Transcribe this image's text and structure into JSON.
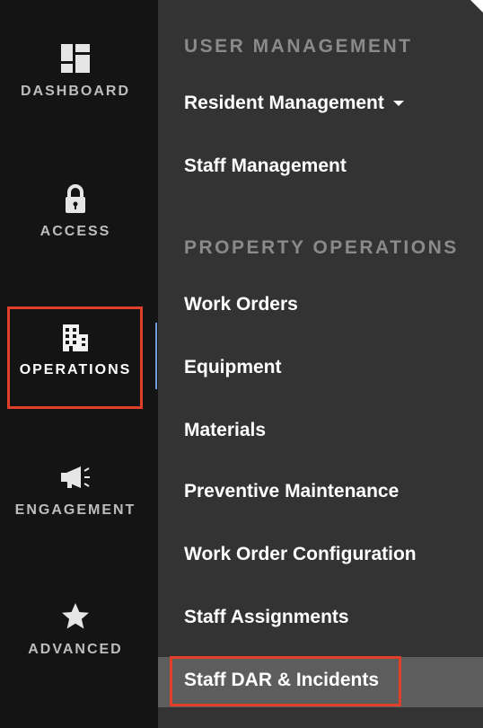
{
  "rail": {
    "items": [
      {
        "label": "DASHBOARD",
        "icon": "dashboard-icon"
      },
      {
        "label": "ACCESS",
        "icon": "lock-icon"
      },
      {
        "label": "OPERATIONS",
        "icon": "building-icon"
      },
      {
        "label": "ENGAGEMENT",
        "icon": "megaphone-icon"
      },
      {
        "label": "ADVANCED",
        "icon": "star-icon"
      }
    ],
    "active": "OPERATIONS"
  },
  "flyout": {
    "sections": [
      {
        "header": "USER MANAGEMENT",
        "items": [
          {
            "label": "Resident Management",
            "has_dropdown": true
          },
          {
            "label": "Staff Management"
          }
        ]
      },
      {
        "header": "PROPERTY OPERATIONS",
        "items": [
          {
            "label": "Work Orders"
          },
          {
            "label": "Equipment"
          },
          {
            "label": "Materials"
          },
          {
            "label": "Preventive Maintenance"
          },
          {
            "label": "Work Order Configuration"
          },
          {
            "label": "Staff Assignments"
          },
          {
            "label": "Staff DAR & Incidents"
          }
        ]
      }
    ],
    "selected": "Staff DAR & Incidents"
  },
  "colors": {
    "rail_bg": "#141414",
    "flyout_bg": "#333333",
    "highlight_box": "#e0402a",
    "active_indicator": "#6f9bd8",
    "selected_item_bg": "#5d5d5d"
  }
}
